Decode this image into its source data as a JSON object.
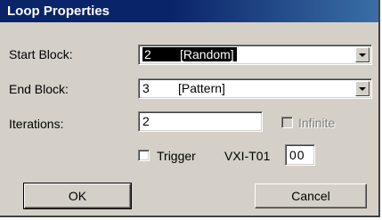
{
  "window": {
    "title": "Loop Properties"
  },
  "start_block": {
    "label": "Start Block:",
    "number": "2",
    "text": "[Random]"
  },
  "end_block": {
    "label": "End Block:",
    "number": "3",
    "text": "[Pattern]"
  },
  "iterations": {
    "label": "Iterations:",
    "value": "2"
  },
  "infinite": {
    "label": "Infinite",
    "checked": false,
    "enabled": false
  },
  "trigger": {
    "label": "Trigger",
    "checked": false
  },
  "vxi": {
    "label": "VXI-T01",
    "value": "00"
  },
  "buttons": {
    "ok": "OK",
    "cancel": "Cancel"
  }
}
